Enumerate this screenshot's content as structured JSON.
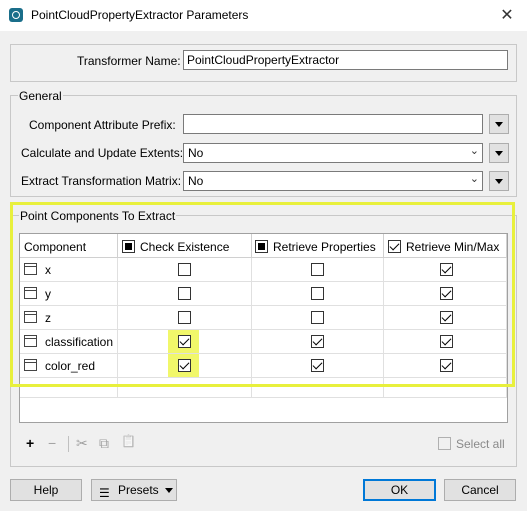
{
  "window": {
    "title": "PointCloudPropertyExtractor Parameters",
    "close_glyph": "✕"
  },
  "transformer": {
    "label": "Transformer Name:",
    "value": "PointCloudPropertyExtractor"
  },
  "general": {
    "legend": "General",
    "prefix_label": "Component Attribute Prefix:",
    "prefix_value": "",
    "extents_label": "Calculate and Update Extents:",
    "extents_value": "No",
    "matrix_label": "Extract Transformation Matrix:",
    "matrix_value": "No"
  },
  "components": {
    "legend": "Point Components To Extract",
    "headers": [
      "Component",
      "Check Existence",
      "Retrieve Properties",
      "Retrieve Min/Max"
    ],
    "header_states": [
      "none",
      "indeterminate",
      "indeterminate",
      "checked"
    ],
    "rows": [
      {
        "name": "x",
        "check_existence": false,
        "retrieve_properties": false,
        "retrieve_minmax": true
      },
      {
        "name": "y",
        "check_existence": false,
        "retrieve_properties": false,
        "retrieve_minmax": true
      },
      {
        "name": "z",
        "check_existence": false,
        "retrieve_properties": false,
        "retrieve_minmax": true
      },
      {
        "name": "classification",
        "check_existence": true,
        "retrieve_properties": true,
        "retrieve_minmax": true
      },
      {
        "name": "color_red",
        "check_existence": true,
        "retrieve_properties": true,
        "retrieve_minmax": true
      }
    ],
    "highlight_color": "#e8f03c"
  },
  "toolbar": {
    "add": "+",
    "remove": "−",
    "cut": "✂",
    "copy": "⧉",
    "paste": "📋",
    "select_all_label": "Select all"
  },
  "buttons": {
    "help": "Help",
    "presets": "Presets",
    "ok": "OK",
    "cancel": "Cancel"
  }
}
